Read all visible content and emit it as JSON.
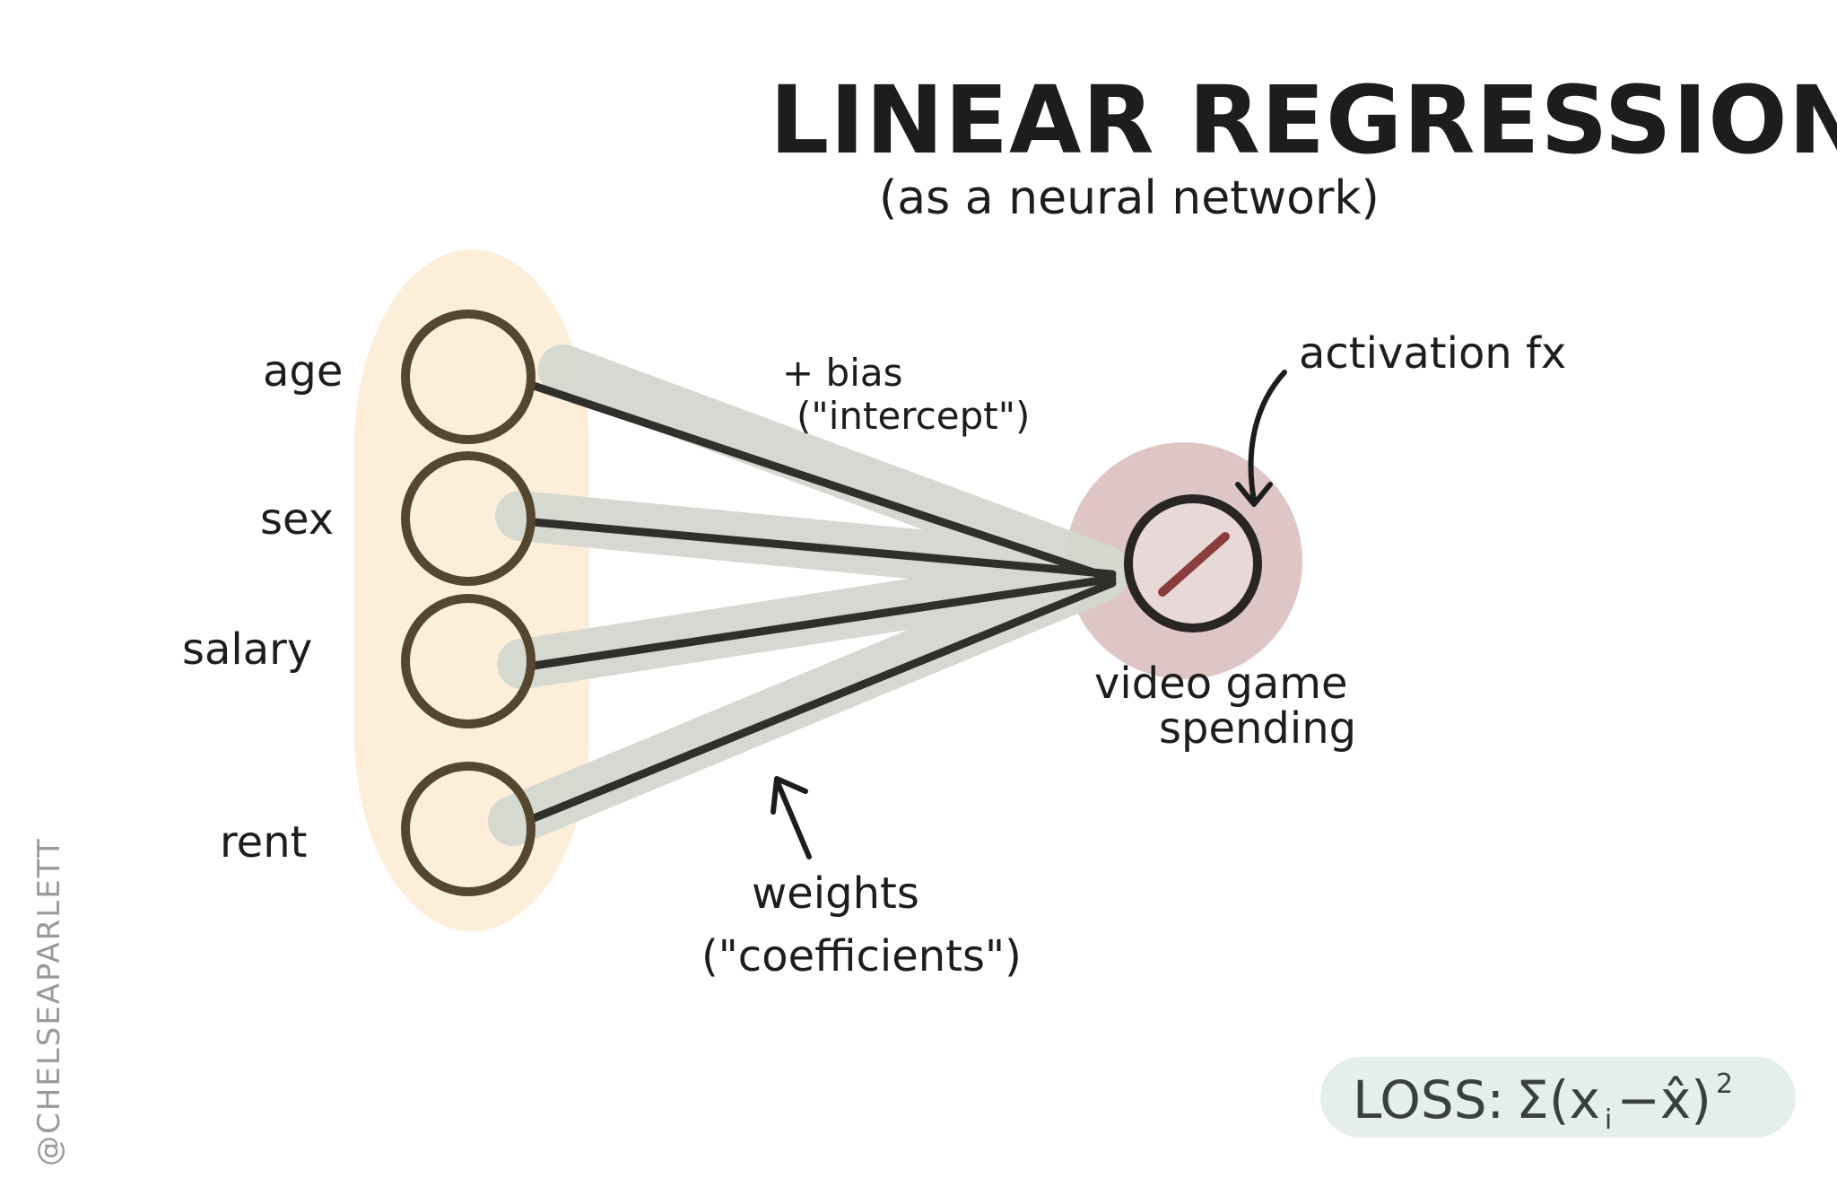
{
  "title": "LINEAR REGRESSION",
  "subtitle": "(as a neural network)",
  "inputs": [
    {
      "label": "age"
    },
    {
      "label": "sex"
    },
    {
      "label": "salary"
    },
    {
      "label": "rent"
    }
  ],
  "output": {
    "label_line1": "video game",
    "label_line2": "spending"
  },
  "annotations": {
    "bias_line1": "+ bias",
    "bias_line2": "(\"intercept\")",
    "weights_line1": "weights",
    "weights_line2": "(\"coefficients\")",
    "activation": "activation fx"
  },
  "loss": {
    "prefix": "LOSS:",
    "formula_main": "Σ(x",
    "formula_sub": "i",
    "formula_rest": "−x̂)",
    "formula_exp": "2"
  },
  "credit": "@CHELSEAPARLETT",
  "colors": {
    "input_highlight": "#fdeed9",
    "connection_shadow": "#d3d8cf",
    "line": "#2f2f2c",
    "node_stroke": "#54462f",
    "node_fill": "#fdeed9",
    "output_halo": "#d9bcbc",
    "output_inner": "#e9d8d8",
    "activation_slash": "#8a3d3d",
    "loss_bg": "#e4efed"
  }
}
